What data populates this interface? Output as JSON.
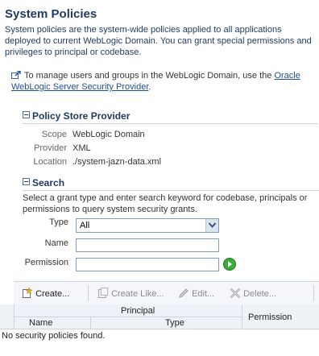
{
  "page": {
    "title": "System Policies",
    "description": "System policies are the system-wide policies applied to all applications deployed to current WebLogic Domain. You can grant special permissions and privileges to principal or codebase.",
    "manage_text": "To manage users and groups in the WebLogic Domain, use the ",
    "manage_link": "Oracle WebLogic Server Security Provider",
    "manage_suffix": "."
  },
  "policy_store": {
    "heading": "Policy Store Provider",
    "scope_label": "Scope",
    "scope_value": "WebLogic Domain",
    "provider_label": "Provider",
    "provider_value": "XML",
    "location_label": "Location",
    "location_value": "./system-jazn-data.xml"
  },
  "search": {
    "heading": "Search",
    "description": "Select a grant type and enter search keyword for codebase, principals or permissions to query system security grants.",
    "type_label": "Type",
    "type_value": "All",
    "name_label": "Name",
    "name_value": "",
    "permission_label": "Permission",
    "permission_value": ""
  },
  "toolbar": {
    "create": "Create...",
    "create_like": "Create Like...",
    "edit": "Edit...",
    "delete": "Delete..."
  },
  "table": {
    "principal_header": "Principal",
    "name_header": "Name",
    "type_header": "Type",
    "permission_header": "Permission",
    "empty_message": "No security policies found."
  }
}
